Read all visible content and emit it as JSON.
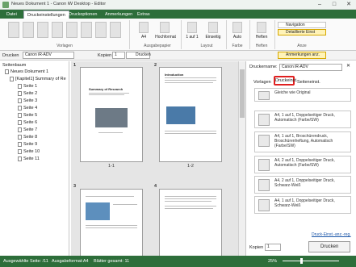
{
  "window": {
    "title": "Neues Dokument 1 - Canon iW Desktop - Editor",
    "minimize": "–",
    "maximize": "□",
    "close": "✕"
  },
  "ribbon_tabs": [
    "Datei",
    "Druckeinstellungen",
    "Druckoptionen",
    "Anmerkungen",
    "Extras"
  ],
  "ribbon": {
    "groups": {
      "vorlagen": "Vorlagen",
      "ausgabepapier": "Ausgabepapier",
      "layout": "Layout",
      "farbe": "Farbe",
      "heften": "Heften",
      "anze": "Anze"
    },
    "buttons": {
      "paper_size": "A4",
      "orientation": "Hochformat",
      "pages_per_sheet": "1 auf 1",
      "duplex": "Einseitig",
      "color": "Auto",
      "staple": "Heften",
      "navigation": "Navigation",
      "detail_view": "Detaillierte Einst"
    }
  },
  "toolbar": {
    "printer_label": "Drucken",
    "printer_value": "Canon iR-ADV",
    "copies_label": "Kopien",
    "copies_value": "1",
    "print_button": "Drucken",
    "annotations_button": "Anmerkungen anz."
  },
  "left_panel": {
    "header": "Seitenbaum",
    "root": "Neues Dokument 1",
    "chapter": "[Kapitel1] Summary of Re",
    "pages": [
      "Seite 1",
      "Seite 2",
      "Seite 3",
      "Seite 4",
      "Seite 5",
      "Seite 6",
      "Seite 7",
      "Seite 8",
      "Seite 9",
      "Seite 10",
      "Seite 11"
    ]
  },
  "center": {
    "pages": [
      {
        "num": "1",
        "label": "1-1",
        "heading": "Summary of Research"
      },
      {
        "num": "2",
        "label": "1-2",
        "heading": "Introduction"
      },
      {
        "num": "3",
        "label": "",
        "heading": ""
      },
      {
        "num": "4",
        "label": "",
        "heading": ""
      }
    ]
  },
  "right_panel": {
    "printer_label": "Druckername:",
    "printer_value": "Canon iR-ADV",
    "tabs": [
      "Vorlagen",
      "Druckeinst.",
      "Seiteneinst."
    ],
    "presets": [
      "Gleiche wie Original",
      "A4, 1 auf 1, Doppelseitiger Druck, Automatisch (Farbe/SW)",
      "A4, 1 auf 1, Broschürendruck, Broschürenheftung, Automatisch (Farbe/SW)",
      "A4, 2 auf 1, Doppelseitiger Druck, Automatisch (Farbe/SW)",
      "A4, 2 auf 1, Doppelseitiger Druck, Schwarz-Weiß",
      "A4, 1 auf 1, Doppelseitiger Druck, Schwarz-Weiß"
    ],
    "link": "Druck-Einst.-anz.-reg.",
    "copies_label": "Kopien",
    "copies_value": "1",
    "print_button": "Drucken"
  },
  "status": {
    "selected": "Ausgewählte Seite: /11",
    "format": "Ausgabeformat:A4",
    "sheets": "Blätter gesamt: 11",
    "zoom": "25%"
  },
  "colors": {
    "accent": "#2d6e3a",
    "highlight": "#e02020"
  }
}
